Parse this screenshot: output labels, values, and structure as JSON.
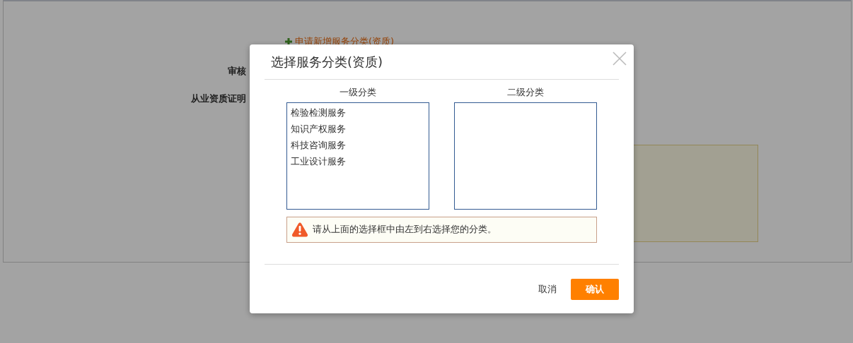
{
  "background_page": {
    "add_link": "申请新增服务分类(资质)",
    "labels": [
      "审核",
      "从业资质证明"
    ]
  },
  "dialog": {
    "title": "选择服务分类(资质)",
    "columns": [
      {
        "heading": "一级分类",
        "items": [
          {
            "label": "检验检测服务",
            "selected": false
          },
          {
            "label": "知识产权服务",
            "selected": false
          },
          {
            "label": "科技咨询服务",
            "selected": false
          },
          {
            "label": "工业设计服务",
            "selected": false
          }
        ]
      },
      {
        "heading": "二级分类"
      }
    ],
    "notice": "请从上面的选择框中由左到右选择您的分类。",
    "buttons": [
      {
        "label": "取消",
        "kind": "link"
      },
      {
        "label": "确认",
        "kind": "primary"
      }
    ]
  }
}
